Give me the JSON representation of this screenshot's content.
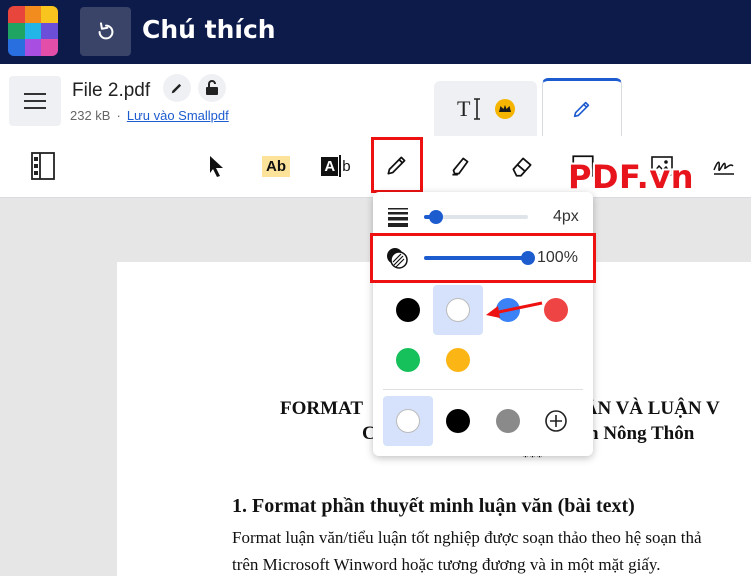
{
  "app": {
    "title": "Chú thích"
  },
  "logo": {
    "colors": [
      "#e8453c",
      "#f28c1e",
      "#f7c51d",
      "#1fa463",
      "#23b5e8",
      "#6c4fd8",
      "#2a6fe0",
      "#a84ee0",
      "#e24ea8"
    ]
  },
  "file": {
    "name": "File 2.pdf",
    "size": "232 kB",
    "separator": "·",
    "save_link": "Lưu vào Smallpdf"
  },
  "tabs": {
    "text_tab_icon": "text-tool-icon",
    "draw_tab_icon": "pencil-icon"
  },
  "toolbar": {
    "items": [
      "thumbnails-icon",
      "select-arrow-icon",
      "text-ab-icon",
      "text-box-icon",
      "pencil-icon",
      "highlighter-icon",
      "eraser-icon",
      "shape-icon",
      "image-icon",
      "signature-icon"
    ],
    "text_badge": "Ab",
    "textbox_badge_a": "A",
    "textbox_badge_b": "b"
  },
  "watermark": "PDF.vn",
  "draw_popover": {
    "thickness_value": "4px",
    "thickness_level": 0.12,
    "opacity_value": "100%",
    "opacity_level": 1.0,
    "colors": [
      "#000000",
      "#ffffff",
      "#3b82f6",
      "#ef4444",
      "#16c05a",
      "#fbb514"
    ],
    "selected_color": "#ffffff",
    "custom_colors": [
      "#ffffff",
      "#000000",
      "#8a8a8a"
    ],
    "add_icon": "plus-circle-icon"
  },
  "document": {
    "title_line1a": "FORMAT",
    "title_line1b": "UẬN VÀ LUẬN V",
    "title_line2a": "C",
    "title_line2b": "n Nông Thôn",
    "stars": "***",
    "heading": "1. Format phần thuyết minh luận văn (bài text)",
    "para_line1": "Format luận văn/tiểu luận tốt nghiệp được soạn thảo theo hệ soạn thả",
    "para_line2": "trên Microsoft Winword hoặc tương đương và in một mặt giấy."
  },
  "accent_color": "#1d5ccf",
  "highlight_color": "#e11111"
}
